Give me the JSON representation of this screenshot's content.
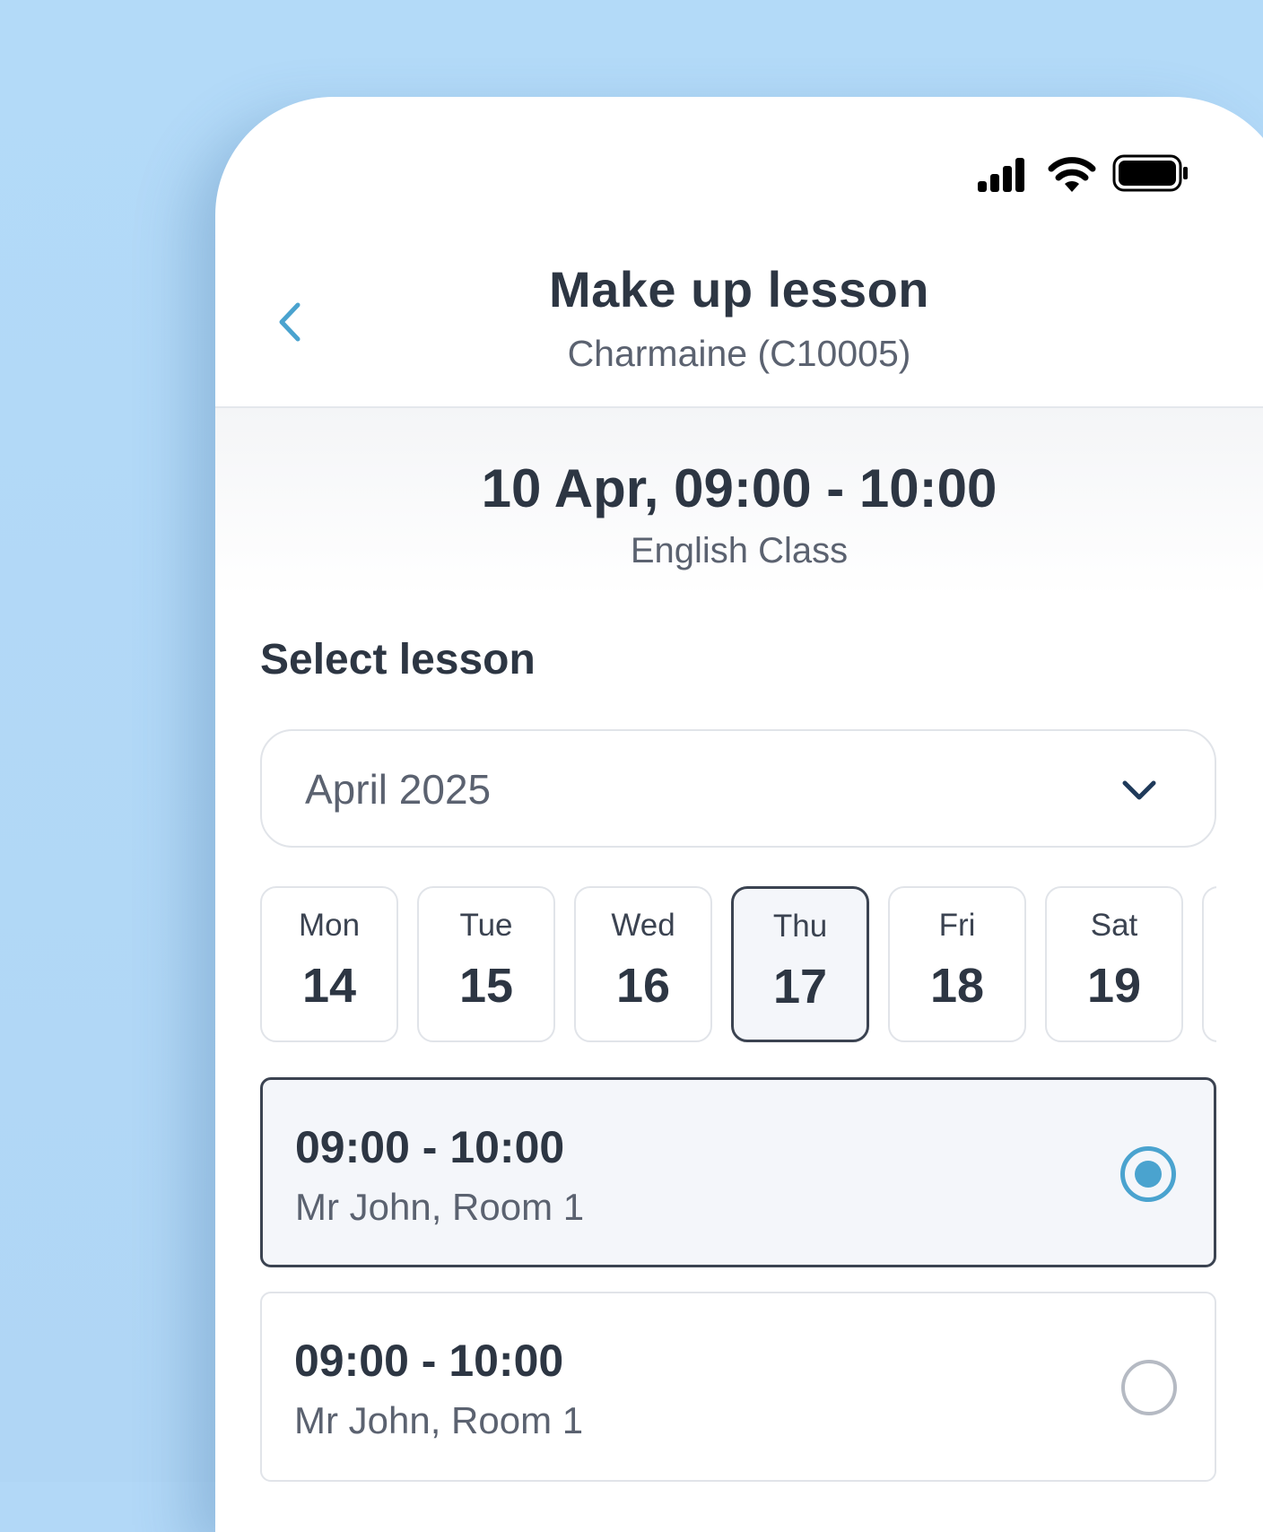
{
  "header": {
    "title": "Make up lesson",
    "subtitle": "Charmaine (C10005)"
  },
  "lesson": {
    "time": "10 Apr, 09:00 - 10:00",
    "class": "English Class"
  },
  "section": {
    "title": "Select lesson"
  },
  "month_select": {
    "value": "April 2025"
  },
  "days": [
    {
      "name": "Mon",
      "num": "14"
    },
    {
      "name": "Tue",
      "num": "15"
    },
    {
      "name": "Wed",
      "num": "16"
    },
    {
      "name": "Thu",
      "num": "17",
      "selected": true
    },
    {
      "name": "Fri",
      "num": "18"
    },
    {
      "name": "Sat",
      "num": "19"
    }
  ],
  "slots": [
    {
      "time": "09:00 - 10:00",
      "room": "Mr John, Room 1",
      "selected": true
    },
    {
      "time": "09:00 - 10:00",
      "room": "Mr John, Room 1",
      "selected": false
    }
  ],
  "colors": {
    "background": "#b2d8f7",
    "accent": "#4aa3cf",
    "text": "#2d3643"
  },
  "icons": [
    "signal-icon",
    "wifi-icon",
    "battery-icon",
    "back-chevron-icon",
    "chevron-down-icon",
    "radio-selected-icon",
    "radio-unselected-icon"
  ]
}
